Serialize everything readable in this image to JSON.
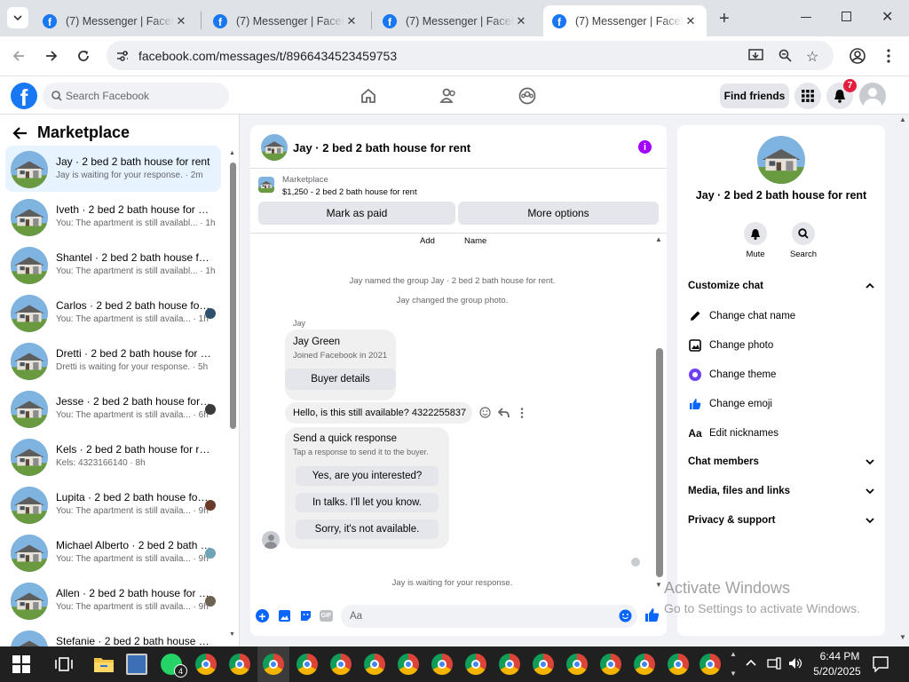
{
  "browser": {
    "tabs": [
      {
        "title": "(7) Messenger | Facebook"
      },
      {
        "title": "(7) Messenger | Facebook"
      },
      {
        "title": "(7) Messenger | Facebook"
      },
      {
        "title": "(7) Messenger | Facebook"
      }
    ],
    "url": "facebook.com/messages/t/8966434523459753"
  },
  "fb": {
    "search_placeholder": "Search Facebook",
    "find_friends": "Find friends",
    "notifications_count": "7"
  },
  "left": {
    "title": "Marketplace",
    "conversations": [
      {
        "name": "Jay · 2 bed 2 bath house for rent",
        "sub": "Jay is waiting for your response. · 2m"
      },
      {
        "name": "Iveth · 2 bed 2 bath house for rent",
        "sub": "You: The apartment is still availabl... · 1h"
      },
      {
        "name": "Shantel · 2 bed 2 bath house for rent",
        "sub": "You: The apartment is still availabl... · 1h"
      },
      {
        "name": "Carlos · 2 bed 2 bath house for rent",
        "sub": "You: The apartment is still availa... · 1h"
      },
      {
        "name": "Dretti · 2 bed 2 bath house for rent",
        "sub": "Dretti is waiting for your response. · 5h"
      },
      {
        "name": "Jesse · 2 bed 2 bath house for rent",
        "sub": "You: The apartment is still availa... · 6h"
      },
      {
        "name": "Kels · 2 bed 2 bath house for rent",
        "sub": "Kels: 4323166140 · 8h"
      },
      {
        "name": "Lupita · 2 bed 2 bath house for rent",
        "sub": "You: The apartment is still availa... · 9h"
      },
      {
        "name": "Michael Alberto · 2 bed 2 bath house for rent",
        "sub": "You: The apartment is still availa... · 9h"
      },
      {
        "name": "Allen · 2 bed 2 bath house for rent",
        "sub": "You: The apartment is still availa... · 9h"
      },
      {
        "name": "Stefanie · 2 bed 2 bath house for rent",
        "sub": ""
      }
    ]
  },
  "chat": {
    "title": "Jay · 2 bed 2 bath house for rent",
    "listing_label": "Marketplace",
    "listing_price": "$1,250 - 2 bed 2 bath house for rent",
    "mark_paid": "Mark as paid",
    "more_options": "More options",
    "add": "Add",
    "name": "Name",
    "system1": "Jay named the group Jay · 2 bed 2 bath house for rent.",
    "system2": "Jay changed the group photo.",
    "sender": "Jay",
    "card_name": "Jay Green",
    "card_joined": "Joined Facebook in 2021",
    "buyer_details": "Buyer details",
    "message": "Hello, is this still available? 4322255837",
    "quick_title": "Send a quick response",
    "quick_sub": "Tap a response to send it to the buyer.",
    "quick_responses": [
      "Yes, are you interested?",
      "In talks. I'll let you know.",
      "Sorry, it's not available."
    ],
    "waiting": "Jay is waiting for your response.",
    "composer_placeholder": "Aa"
  },
  "right": {
    "title": "Jay · 2 bed 2 bath house for rent",
    "mute": "Mute",
    "search": "Search",
    "customize": "Customize chat",
    "items": [
      "Change chat name",
      "Change photo",
      "Change theme",
      "Change emoji",
      "Edit nicknames"
    ],
    "chat_members": "Chat members",
    "media": "Media, files and links",
    "privacy": "Privacy & support",
    "theme_color": "#6e3ff3"
  },
  "windows": {
    "activate_title": "Activate Windows",
    "activate_sub": "Go to Settings to activate Windows.",
    "time": "6:44 PM",
    "date": "5/20/2025",
    "whatsapp_badge": "4"
  }
}
